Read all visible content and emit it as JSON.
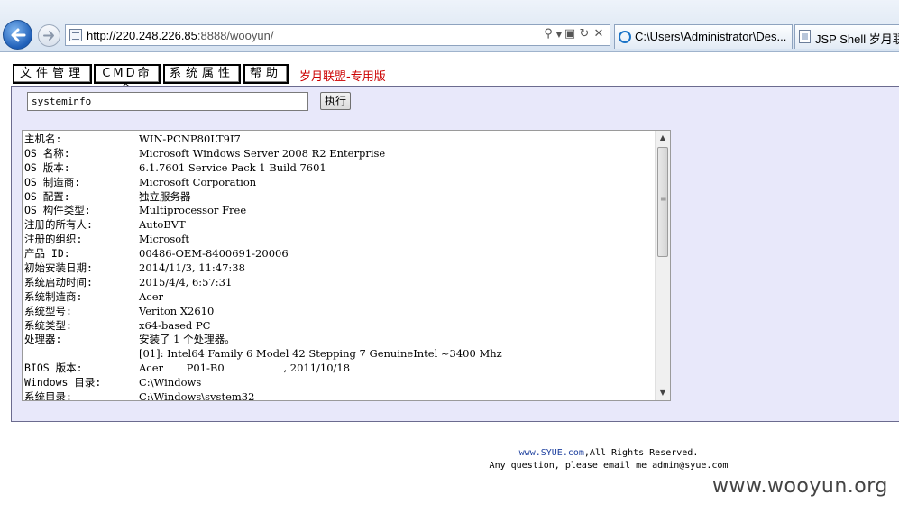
{
  "browser": {
    "url_prefix": "http://220.248.226.85",
    "url_suffix": ":8888/wooyun/",
    "tabs": [
      {
        "label": "C:\\Users\\Administrator\\Des...",
        "icon": "ie-icon",
        "active": true
      },
      {
        "label": "JSP Shell 岁月联",
        "icon": "document-icon",
        "active": false
      }
    ],
    "close_glyph": "×"
  },
  "menu": {
    "items": [
      {
        "label": "文件管理"
      },
      {
        "label": "CMD命令"
      },
      {
        "label": "系统属性"
      },
      {
        "label": "帮助"
      }
    ],
    "brand": "岁月联盟-专用版"
  },
  "command": {
    "value": "systeminfo",
    "exec_label": "执行"
  },
  "output": {
    "lines": [
      {
        "key": "主机名:",
        "value": "WIN-PCNP80LT9I7"
      },
      {
        "key": "OS 名称:",
        "value": "Microsoft Windows Server 2008 R2 Enterprise"
      },
      {
        "key": "OS 版本:",
        "value": "6.1.7601 Service Pack 1 Build 7601"
      },
      {
        "key": "OS 制造商:",
        "value": "Microsoft Corporation"
      },
      {
        "key": "OS 配置:",
        "value": "独立服务器"
      },
      {
        "key": "OS 构件类型:",
        "value": "Multiprocessor Free"
      },
      {
        "key": "注册的所有人:",
        "value": "AutoBVT"
      },
      {
        "key": "注册的组织:",
        "value": "Microsoft"
      },
      {
        "key": "产品 ID:",
        "value": "00486-OEM-8400691-20006"
      },
      {
        "key": "初始安装日期:",
        "value": "2014/11/3, 11:47:38"
      },
      {
        "key": "系统启动时间:",
        "value": "2015/4/4, 6:57:31"
      },
      {
        "key": "系统制造商:",
        "value": "Acer"
      },
      {
        "key": "系统型号:",
        "value": "Veriton X2610"
      },
      {
        "key": "系统类型:",
        "value": "x64-based PC"
      },
      {
        "key": "处理器:",
        "value": "安装了 1 个处理器。"
      },
      {
        "key": "",
        "value": "[01]: Intel64 Family 6 Model 42 Stepping 7 GenuineIntel ~3400 Mhz"
      },
      {
        "key": "BIOS 版本:",
        "value": "Acer       P01-B0                  , 2011/10/18"
      },
      {
        "key": "Windows 目录:",
        "value": "C:\\Windows"
      },
      {
        "key": "系统目录:",
        "value": "C:\\Windows\\system32"
      }
    ]
  },
  "footer": {
    "link": "www.SYUE.com",
    "rights": ",All Rights Reserved.",
    "contact": "Any question, please email me admin@syue.com"
  },
  "watermark": "www.wooyun.org"
}
